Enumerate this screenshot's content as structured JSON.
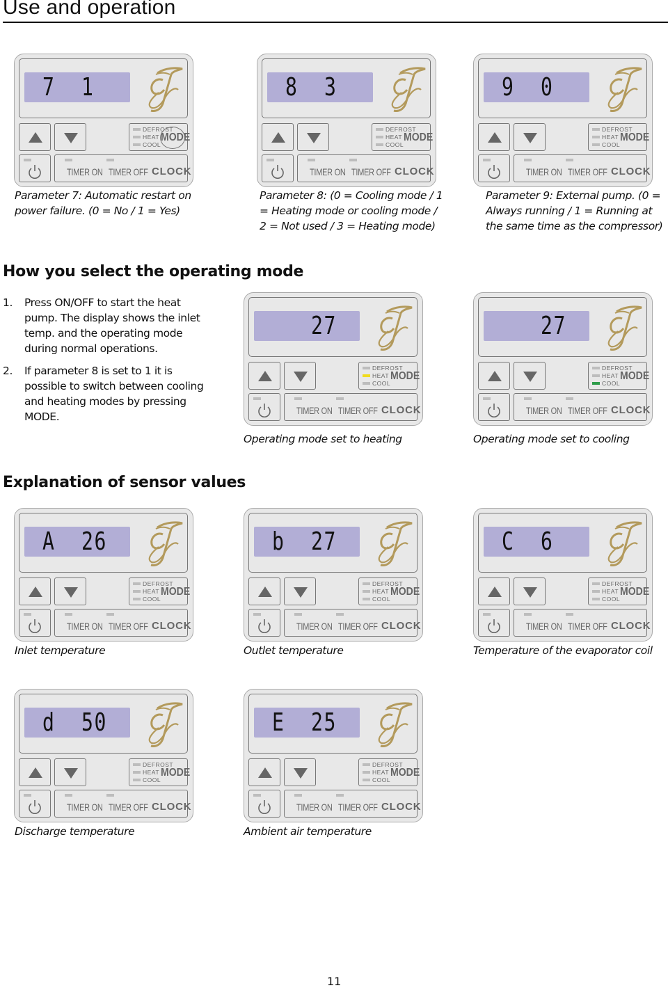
{
  "page": {
    "title": "Use and operation",
    "page_number": "11"
  },
  "panel_labels": {
    "mode": "MODE",
    "defrost": "DEFROST",
    "heat": "HEAT",
    "cool": "COOL",
    "timer_on": "TIMER ON",
    "timer_off": "TIMER OFF",
    "clock": "CLOCK",
    "icons": {
      "up": "up-arrow-icon",
      "down": "down-arrow-icon",
      "power": "power-icon",
      "logo": "gj-monogram-logo"
    },
    "colors": {
      "lcd": "#b2aed6",
      "heat_led_on": "#f0dc1e",
      "cool_led_on": "#2e9c4a",
      "led_off": "#bdbdbd",
      "logo_gold": "#b39a5c"
    }
  },
  "parameters_section": {
    "panels": [
      {
        "id": "param-7",
        "lcd_left": "7",
        "lcd_right": "1",
        "active_mode": "",
        "mode_highlighted": true,
        "caption": "Parameter 7: Automatic restart on power failure. (0 = No / 1 = Yes)"
      },
      {
        "id": "param-8",
        "lcd_left": "8",
        "lcd_right": "3",
        "active_mode": "",
        "mode_highlighted": false,
        "caption": "Parameter 8: (0 = Cooling mode / 1 = Heating mode or cooling mode / 2 = Not used / 3 = Heating mode)"
      },
      {
        "id": "param-9",
        "lcd_left": "9",
        "lcd_right": "0",
        "active_mode": "",
        "mode_highlighted": false,
        "caption": "Parameter 9: External pump. (0 = Always running / 1 = Running at the same time as the compressor)"
      }
    ]
  },
  "operating_mode_section": {
    "heading": "How you select the operating mode",
    "steps": [
      {
        "number": "1.",
        "text": "Press ON/OFF to start the heat pump. The display shows the inlet temp. and the operating mode during normal operations."
      },
      {
        "number": "2.",
        "text": "If parameter 8 is set to 1 it is possible to switch between cooling and heating modes by pressing MODE."
      }
    ],
    "panels": [
      {
        "id": "mode-heating",
        "lcd_left": "",
        "lcd_right": "27",
        "active_mode": "heat",
        "mode_highlighted": false,
        "caption": "Operating mode set to heating"
      },
      {
        "id": "mode-cooling",
        "lcd_left": "",
        "lcd_right": "27",
        "active_mode": "cool",
        "mode_highlighted": false,
        "caption": "Operating mode set to cooling"
      }
    ]
  },
  "sensor_section": {
    "heading": "Explanation of sensor values",
    "panels": [
      {
        "id": "sensor-a",
        "lcd_left": "A",
        "lcd_right": "26",
        "active_mode": "",
        "mode_highlighted": false,
        "caption": "Inlet temperature"
      },
      {
        "id": "sensor-b",
        "lcd_left": "b",
        "lcd_right": "27",
        "active_mode": "",
        "mode_highlighted": false,
        "caption": "Outlet temperature"
      },
      {
        "id": "sensor-c",
        "lcd_left": "C",
        "lcd_right": "6",
        "active_mode": "",
        "mode_highlighted": false,
        "caption": "Temperature of the evaporator coil"
      },
      {
        "id": "sensor-d",
        "lcd_left": "d",
        "lcd_right": "50",
        "active_mode": "",
        "mode_highlighted": false,
        "caption": "Discharge temperature"
      },
      {
        "id": "sensor-e",
        "lcd_left": "E",
        "lcd_right": "25",
        "active_mode": "",
        "mode_highlighted": false,
        "caption": "Ambient air temperature"
      }
    ]
  }
}
